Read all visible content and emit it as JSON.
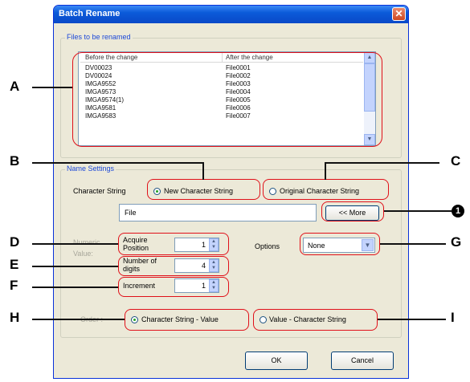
{
  "dialog": {
    "title": "Batch Rename"
  },
  "files_group": {
    "label": "Files to be renamed",
    "columns": [
      "Before the change",
      "After the change"
    ],
    "rows": [
      [
        "DV00023",
        "File0001"
      ],
      [
        "DV00024",
        "File0002"
      ],
      [
        "IMGA9552",
        "File0003"
      ],
      [
        "IMGA9573",
        "File0004"
      ],
      [
        "IMGA9574(1)",
        "File0005"
      ],
      [
        "IMGA9581",
        "File0006"
      ],
      [
        "IMGA9583",
        "File0007"
      ]
    ]
  },
  "name_settings": {
    "label": "Name Settings",
    "character_string_label": "Character String",
    "new_string_option": "New Character String",
    "original_string_option": "Original Character String",
    "selected_option": "New Character String",
    "string_value": "File",
    "more_button": "<< More",
    "numeric_value_label": "Numeric Value:",
    "acquire_position_label": "Acquire Position",
    "acquire_position_value": "1",
    "digits_label": "Number of digits",
    "digits_value": "4",
    "increment_label": "Increment",
    "increment_value": "1",
    "options_label": "Options",
    "options_value": "None",
    "order_label": "Order :",
    "order_option_1": "Character String - Value",
    "order_option_2": "Value - Character String",
    "order_selected": "Character String - Value"
  },
  "buttons": {
    "ok": "OK",
    "cancel": "Cancel"
  },
  "callouts": {
    "A": "A",
    "B": "B",
    "C": "C",
    "D": "D",
    "E": "E",
    "F": "F",
    "G": "G",
    "H": "H",
    "I": "I",
    "one": "1"
  }
}
